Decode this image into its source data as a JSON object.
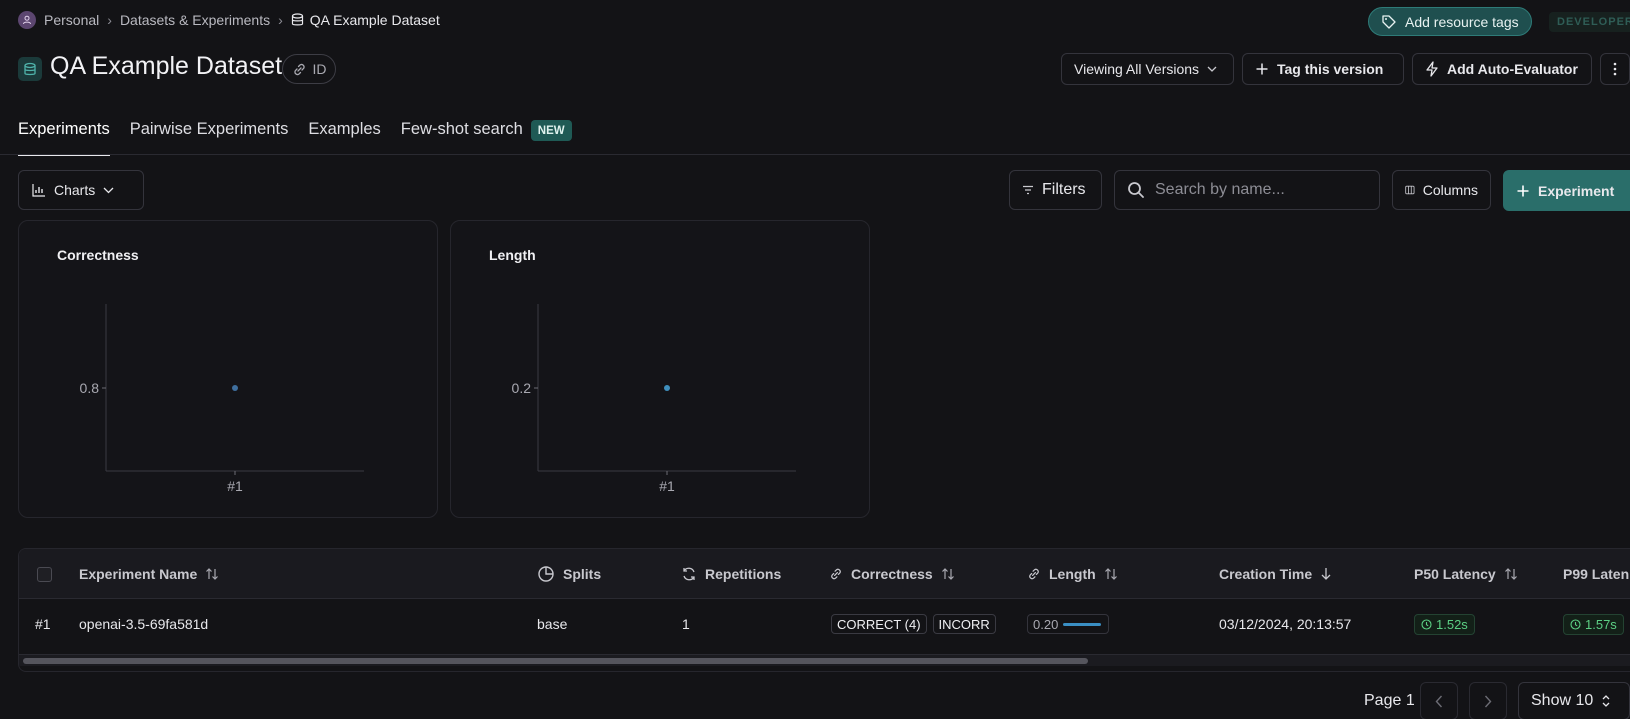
{
  "breadcrumb": {
    "items": [
      "Personal",
      "Datasets & Experiments",
      "QA Example Dataset"
    ]
  },
  "header": {
    "add_tags_label": "Add resource tags",
    "developer_badge": "DEVELOPER",
    "title": "QA Example Dataset",
    "id_label": "ID",
    "versions_label": "Viewing All Versions",
    "tag_version_label": "Tag this version",
    "auto_eval_label": "Add Auto-Evaluator"
  },
  "tabs": [
    {
      "label": "Experiments",
      "active": true
    },
    {
      "label": "Pairwise Experiments"
    },
    {
      "label": "Examples"
    },
    {
      "label": "Few-shot search",
      "badge": "NEW"
    }
  ],
  "toolbar": {
    "charts_label": "Charts",
    "filters_label": "Filters",
    "search_placeholder": "Search by name...",
    "columns_label": "Columns",
    "experiment_label": "Experiment"
  },
  "chart_data": [
    {
      "type": "scatter",
      "title": "Correctness",
      "categories": [
        "#1"
      ],
      "values": [
        0.8
      ],
      "yticks": [
        "0.8"
      ],
      "color": "#3f6f9e"
    },
    {
      "type": "scatter",
      "title": "Length",
      "categories": [
        "#1"
      ],
      "values": [
        0.2
      ],
      "yticks": [
        "0.2"
      ],
      "color": "#3f8fbd"
    }
  ],
  "table": {
    "headers": {
      "name": "Experiment Name",
      "splits": "Splits",
      "repetitions": "Repetitions",
      "correctness": "Correctness",
      "length": "Length",
      "creation_time": "Creation Time",
      "p50": "P50 Latency",
      "p99": "P99 Laten"
    },
    "rows": [
      {
        "index": "#1",
        "name": "openai-3.5-69fa581d",
        "splits": "base",
        "repetitions": "1",
        "correct": "CORRECT (4)",
        "incorrect": "INCORR",
        "length": "0.20",
        "creation_time": "03/12/2024, 20:13:57",
        "p50": "1.52s",
        "p99": "1.57s"
      }
    ]
  },
  "pagination": {
    "page_label": "Page 1",
    "show_label": "Show 10"
  },
  "colors": {
    "accent": "#2a6e6a",
    "latency_green": "#5ccf84"
  }
}
